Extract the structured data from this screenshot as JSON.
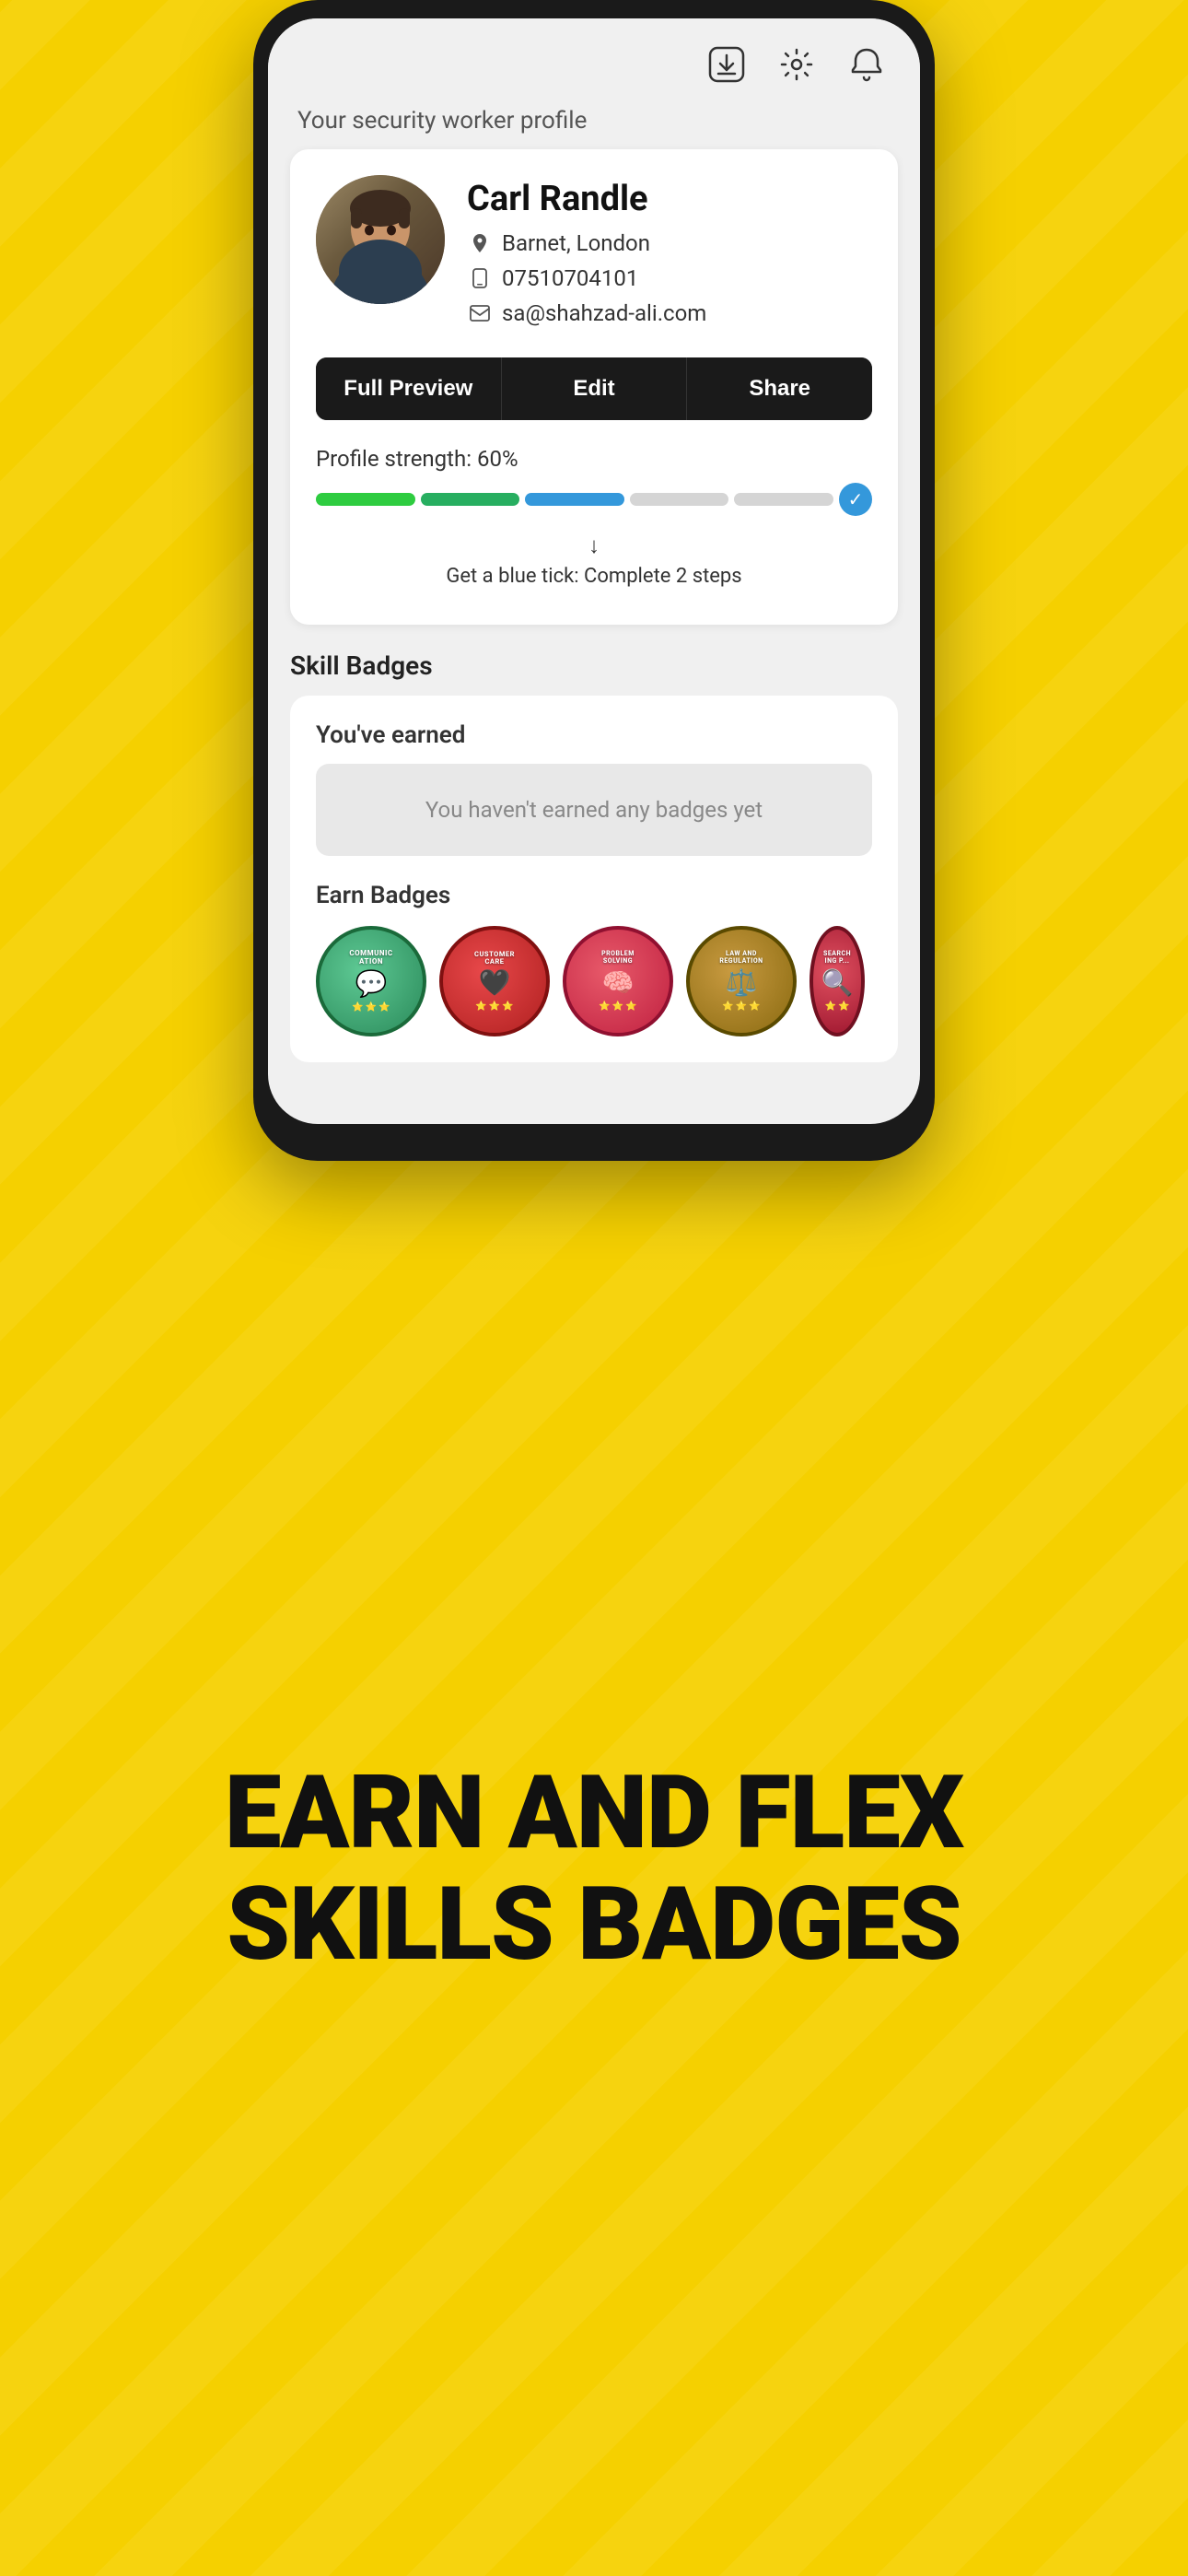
{
  "header": {
    "section_label": "Your security worker profile"
  },
  "profile": {
    "name": "Carl Randle",
    "location": "Barnet, London",
    "phone": "07510704101",
    "email": "sa@shahzad-ali.com",
    "buttons": {
      "preview": "Full Preview",
      "edit": "Edit",
      "share": "Share"
    },
    "strength": {
      "label": "Profile strength: 60%",
      "hint": "Get a blue tick: Complete 2 steps"
    }
  },
  "skill_badges": {
    "section_title": "Skill Badges",
    "earned_header": "You've earned",
    "empty_message": "You haven't earned any badges yet",
    "earn_header": "Earn Badges",
    "badges": [
      {
        "name": "Communication",
        "emoji": "💬",
        "color": "communication"
      },
      {
        "name": "Customer Care",
        "emoji": "🖤",
        "color": "customer"
      },
      {
        "name": "Problem Solving",
        "emoji": "🧠",
        "color": "problem"
      },
      {
        "name": "Law and Regulation",
        "emoji": "⚖️",
        "color": "law"
      },
      {
        "name": "Searching P...",
        "emoji": "🔍",
        "color": "searching"
      }
    ]
  },
  "marketing": {
    "line1": "EARN AND FLEX",
    "line2": "SKILLS BADGES"
  },
  "icons": {
    "download": "⬇",
    "settings": "⚙",
    "bell": "🔔",
    "location": "📍",
    "phone": "📱",
    "email": "✉",
    "check": "✓",
    "arrow_down": "↓"
  }
}
